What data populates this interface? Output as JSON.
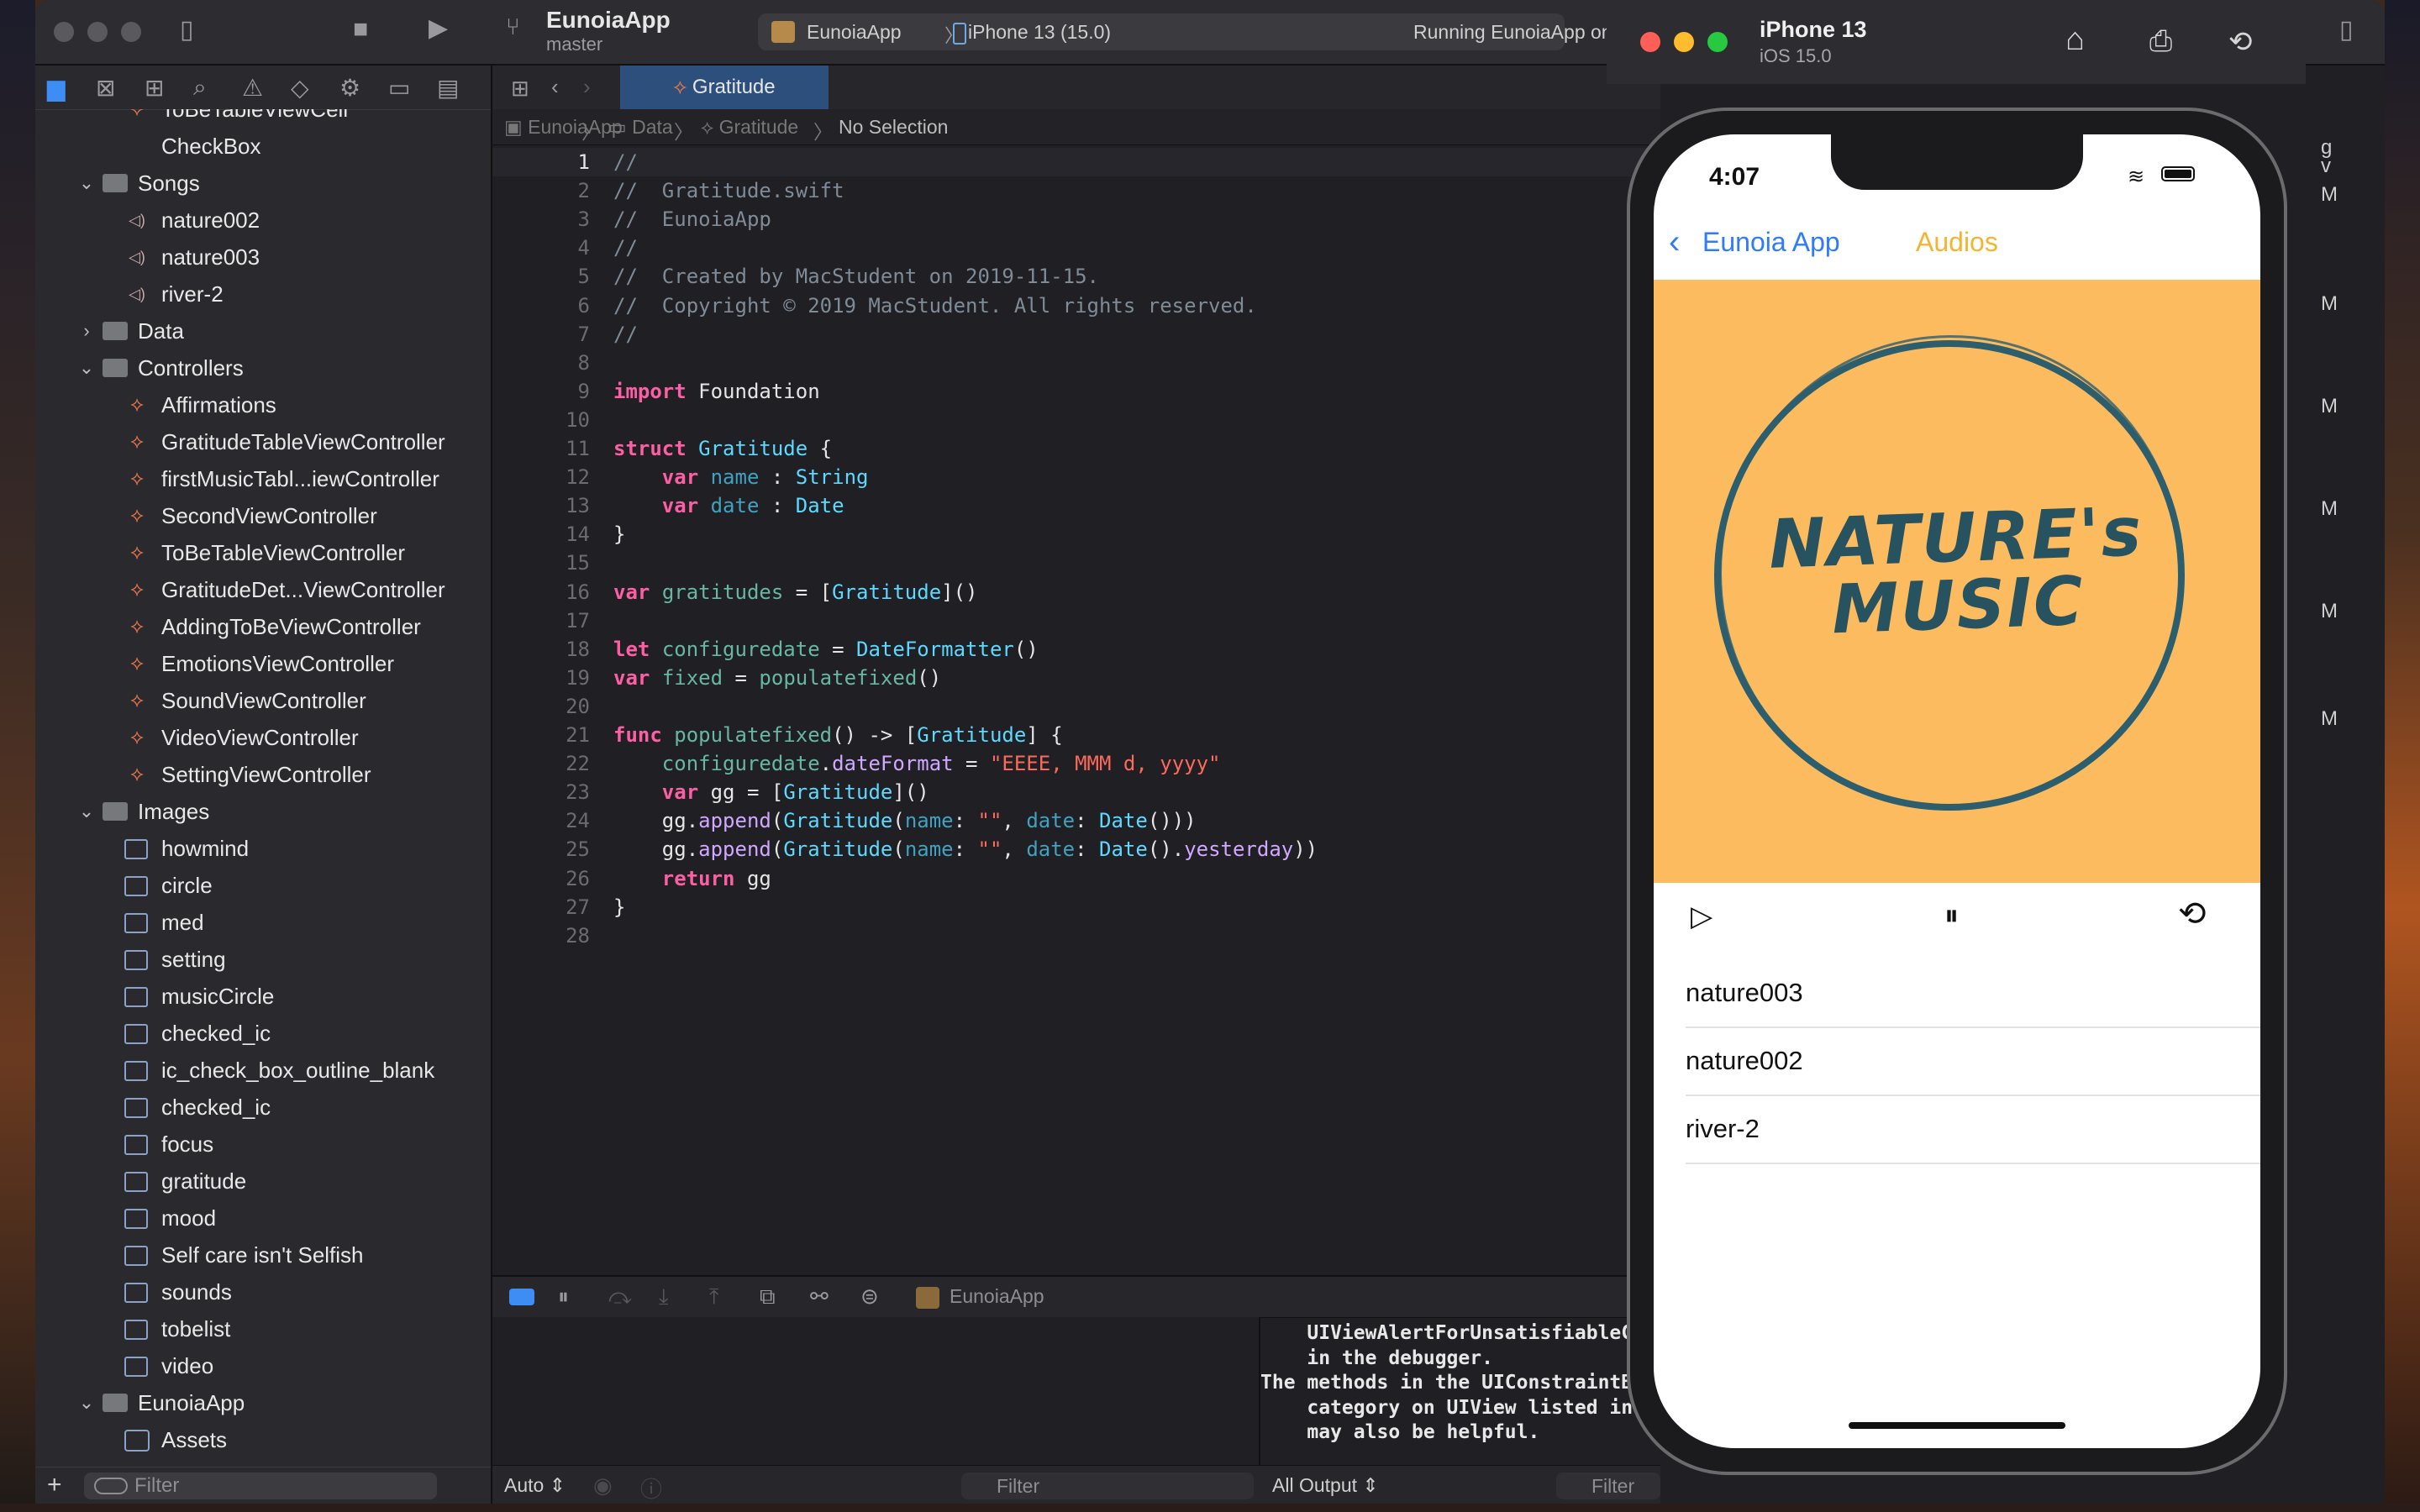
{
  "window": {
    "project_name": "EunoiaApp",
    "branch": "master",
    "scheme_app": "EunoiaApp",
    "scheme_device": "iPhone 13 (15.0)",
    "status": "Running EunoiaApp on iPh"
  },
  "navigator": {
    "items": [
      {
        "label": "ToBeTableViewCell",
        "icon": "swift-icon",
        "level": 2
      },
      {
        "label": "CheckBox",
        "icon": "none",
        "level": 2
      },
      {
        "label": "Songs",
        "icon": "folder-icon",
        "level": 1,
        "chevron": "down"
      },
      {
        "label": "nature002",
        "icon": "audio-icon",
        "level": 2
      },
      {
        "label": "nature003",
        "icon": "audio-icon",
        "level": 2
      },
      {
        "label": "river-2",
        "icon": "audio-icon",
        "level": 2
      },
      {
        "label": "Data",
        "icon": "folder-icon",
        "level": 1,
        "chevron": "right"
      },
      {
        "label": "Controllers",
        "icon": "folder-icon",
        "level": 1,
        "chevron": "down"
      },
      {
        "label": "Affirmations",
        "icon": "swift-icon",
        "level": 2
      },
      {
        "label": "GratitudeTableViewController",
        "icon": "swift-icon",
        "level": 2
      },
      {
        "label": "firstMusicTabl...iewController",
        "icon": "swift-icon",
        "level": 2
      },
      {
        "label": "SecondViewController",
        "icon": "swift-icon",
        "level": 2
      },
      {
        "label": "ToBeTableViewController",
        "icon": "swift-icon",
        "level": 2
      },
      {
        "label": "GratitudeDet...ViewController",
        "icon": "swift-icon",
        "level": 2
      },
      {
        "label": "AddingToBeViewController",
        "icon": "swift-icon",
        "level": 2
      },
      {
        "label": "EmotionsViewController",
        "icon": "swift-icon",
        "level": 2
      },
      {
        "label": "SoundViewController",
        "icon": "swift-icon",
        "level": 2
      },
      {
        "label": "VideoViewController",
        "icon": "swift-icon",
        "level": 2
      },
      {
        "label": "SettingViewController",
        "icon": "swift-icon",
        "level": 2
      },
      {
        "label": "Images",
        "icon": "folder-icon",
        "level": 1,
        "chevron": "down"
      },
      {
        "label": "howmind",
        "icon": "image-icon",
        "level": 2
      },
      {
        "label": "circle",
        "icon": "image-icon",
        "level": 2
      },
      {
        "label": "med",
        "icon": "image-icon",
        "level": 2
      },
      {
        "label": "setting",
        "icon": "image-icon",
        "level": 2
      },
      {
        "label": "musicCircle",
        "icon": "image-icon",
        "level": 2
      },
      {
        "label": "checked_ic",
        "icon": "image-icon",
        "level": 2
      },
      {
        "label": "ic_check_box_outline_blank",
        "icon": "image-icon",
        "level": 2
      },
      {
        "label": "checked_ic",
        "icon": "image-icon",
        "level": 2
      },
      {
        "label": "focus",
        "icon": "image-icon",
        "level": 2
      },
      {
        "label": "gratitude",
        "icon": "image-icon",
        "level": 2
      },
      {
        "label": "mood",
        "icon": "image-icon",
        "level": 2
      },
      {
        "label": "Self care isn't Selfish",
        "icon": "image-icon",
        "level": 2
      },
      {
        "label": "sounds",
        "icon": "image-icon",
        "level": 2
      },
      {
        "label": "tobelist",
        "icon": "image-icon",
        "level": 2
      },
      {
        "label": "video",
        "icon": "image-icon",
        "level": 2
      },
      {
        "label": "EunoiaApp",
        "icon": "folder-icon",
        "level": 1,
        "chevron": "down"
      },
      {
        "label": "Assets",
        "icon": "assets-icon",
        "level": 2
      }
    ],
    "filter_placeholder": "Filter"
  },
  "editor": {
    "tab": "Gratitude",
    "breadcrumb": [
      "EunoiaApp",
      "Data",
      "Gratitude",
      "No Selection"
    ],
    "code": [
      "//",
      "//  Gratitude.swift",
      "//  EunoiaApp",
      "//",
      "//  Created by MacStudent on 2019-11-15.",
      "//  Copyright © 2019 MacStudent. All rights reserved.",
      "//",
      "",
      "import Foundation",
      "",
      "struct Gratitude {",
      "    var name : String",
      "    var date : Date",
      "}",
      "",
      "var gratitudes = [Gratitude]()",
      "",
      "let configuredate = DateFormatter()",
      "var fixed = populatefixed()",
      "",
      "func populatefixed() -> [Gratitude] {",
      "    configuredate.dateFormat = \"EEEE, MMM d, yyyy\"",
      "    var gg = [Gratitude]()",
      "    gg.append(Gratitude(name: \"\", date: Date()))",
      "    gg.append(Gratitude(name: \"\", date: Date().yesterday))",
      "    return gg",
      "}",
      ""
    ]
  },
  "debug": {
    "target": "EunoiaApp",
    "console_lines": [
      "    UIViewAlertForUnsatisfiableC",
      "    in the debugger.",
      "The methods in the UIConstraintB",
      "    category on UIView listed in",
      "    may also be helpful."
    ],
    "auto_label": "Auto",
    "filter_placeholder": "Filter",
    "output_label": "All Output",
    "console_filter_placeholder": "Filter"
  },
  "inspector_letters": [
    "g",
    "v",
    "M",
    "M",
    "M",
    "M",
    "M",
    "M"
  ],
  "simulator": {
    "device": "iPhone 13",
    "os": "iOS 15.0",
    "time": "4:07",
    "back_label": "Eunoia App",
    "nav_title": "Audios",
    "artwork_text_line1": "NATURE's",
    "artwork_text_line2": "MUSIC",
    "songs": [
      "nature003",
      "nature002",
      "river-2"
    ]
  },
  "colors": {
    "accent_blue": "#2f7cf6",
    "nav_title": "#f3b531",
    "artwork_bg": "#fdbb5f",
    "artwork_ink": "#27525f",
    "swift_orange": "#e8774d",
    "selected_tab": "#2d4f7c"
  }
}
